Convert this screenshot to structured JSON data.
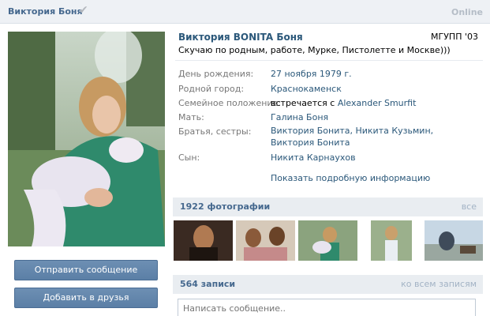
{
  "header": {
    "name": "Виктория Боня",
    "online": "Online"
  },
  "profile": {
    "full_name": "Виктория BONITA Боня",
    "education": "МГУПП '03",
    "status": "Скучаю по родным, работе, Мурке, Пистолетте и Москве)))",
    "info": [
      {
        "label": "День рождения:",
        "value": "27 ноября 1979 г."
      },
      {
        "label": "Родной город:",
        "value": "Краснокаменск"
      },
      {
        "label": "Семейное положение:",
        "value_prefix": "встречается с",
        "value": "Alexander Smurfit"
      },
      {
        "label": "Мать:",
        "value": "Галина Боня"
      },
      {
        "label": "Братья, сестры:",
        "value": "Виктория Бонита, Никита Кузьмин, Виктория Бонита"
      },
      {
        "label": "Сын:",
        "value": "Никита Карнаухов"
      }
    ],
    "more_link": "Показать подробную информацию"
  },
  "actions": {
    "send_message": "Отправить сообщение",
    "add_friend": "Добавить в друзья"
  },
  "photos": {
    "title": "1922 фотографии",
    "all_link": "все"
  },
  "posts": {
    "title": "564 записи",
    "all_link": "ко всем записям",
    "input_placeholder": "Написать сообщение.."
  },
  "colors": {
    "link": "#2b587a",
    "header_text": "#45688e",
    "button": "#5b7fa6",
    "section_bg": "#e9edf1"
  },
  "icons": {
    "verified": "checkmark-icon"
  }
}
